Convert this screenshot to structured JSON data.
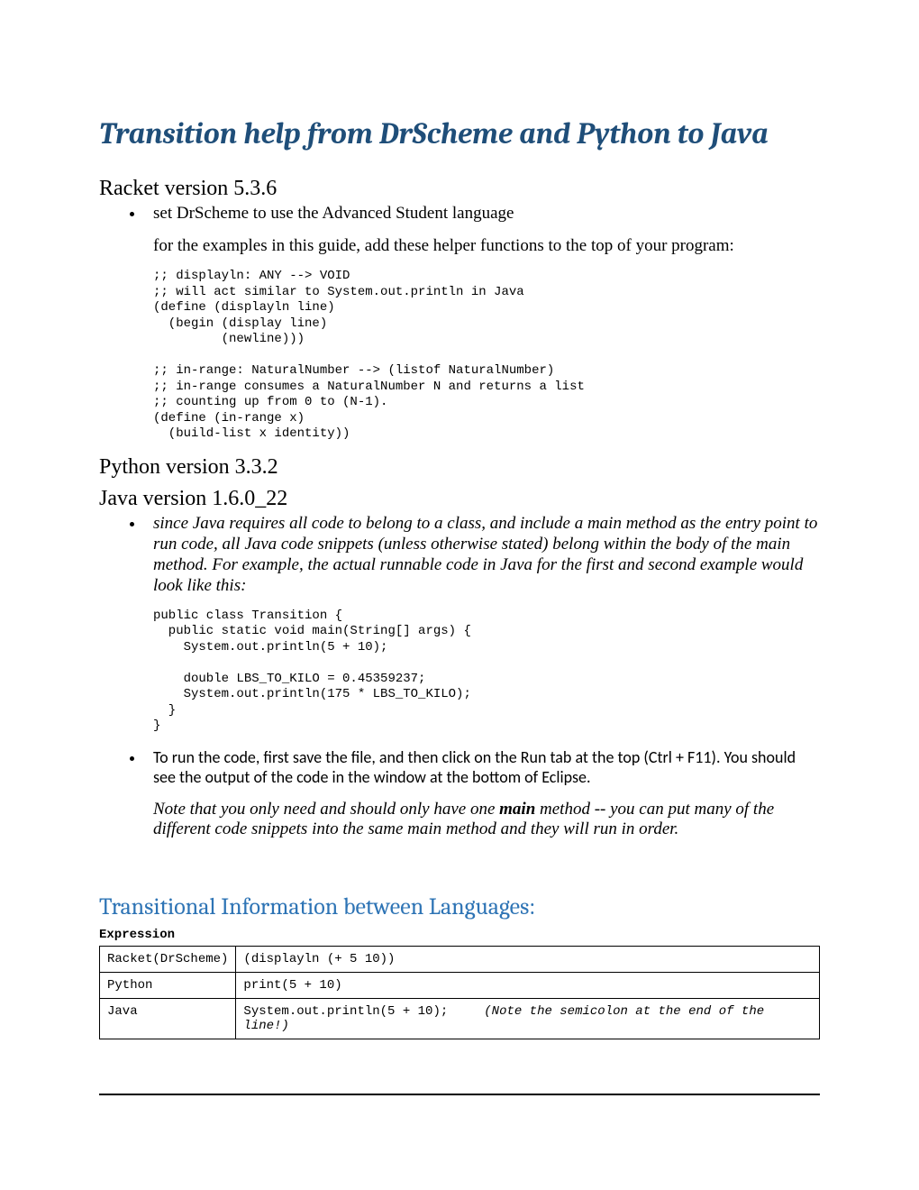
{
  "title": "Transition help from DrScheme and Python to Java",
  "racket": {
    "heading": "Racket version 5.3.6",
    "bullets": [
      "set DrScheme to use the Advanced Student language"
    ],
    "lead_in": "for the examples in this guide, add these helper functions to the top of your program:",
    "code": ";; displayln: ANY --> VOID\n;; will act similar to System.out.println in Java\n(define (displayln line)\n  (begin (display line)\n         (newline)))\n\n;; in-range: NaturalNumber --> (listof NaturalNumber)\n;; in-range consumes a NaturalNumber N and returns a list\n;; counting up from 0 to (N-1).\n(define (in-range x)\n  (build-list x identity))"
  },
  "python_heading": "Python version 3.3.2",
  "java_heading": "Java version 1.6.0_22",
  "java": {
    "bullet1": "since Java requires all code to belong to a class, and include a main method as the entry point to run code, all Java code snippets (unless otherwise stated) belong within the body of the main method. For example, the actual runnable code in Java for the first and second example would look like this:",
    "code": "public class Transition {\n  public static void main(String[] args) {\n    System.out.println(5 + 10);\n\n    double LBS_TO_KILO = 0.45359237;\n    System.out.println(175 * LBS_TO_KILO);\n  }\n}",
    "bullet2": "To run the code, first save the file, and then click on the Run tab at the top (Ctrl + F11).  You should see the output of the code in the window at the bottom of Eclipse.",
    "note_pre": "Note that you only need and should only have one ",
    "note_main": "main",
    "note_post": " method -- you can put many of the different code snippets into the same main method and they will run in order."
  },
  "transitional_heading": "Transitional Information between Languages:",
  "expression_caption": "Expression",
  "table": {
    "rows": [
      {
        "lang": "Racket(DrScheme)",
        "code": "(displayln (+ 5 10))",
        "note": ""
      },
      {
        "lang": "Python",
        "code": "print(5 + 10)",
        "note": ""
      },
      {
        "lang": "Java",
        "code": "System.out.println(5 + 10);",
        "note": "(Note the semicolon at the end of the line!)"
      }
    ]
  }
}
